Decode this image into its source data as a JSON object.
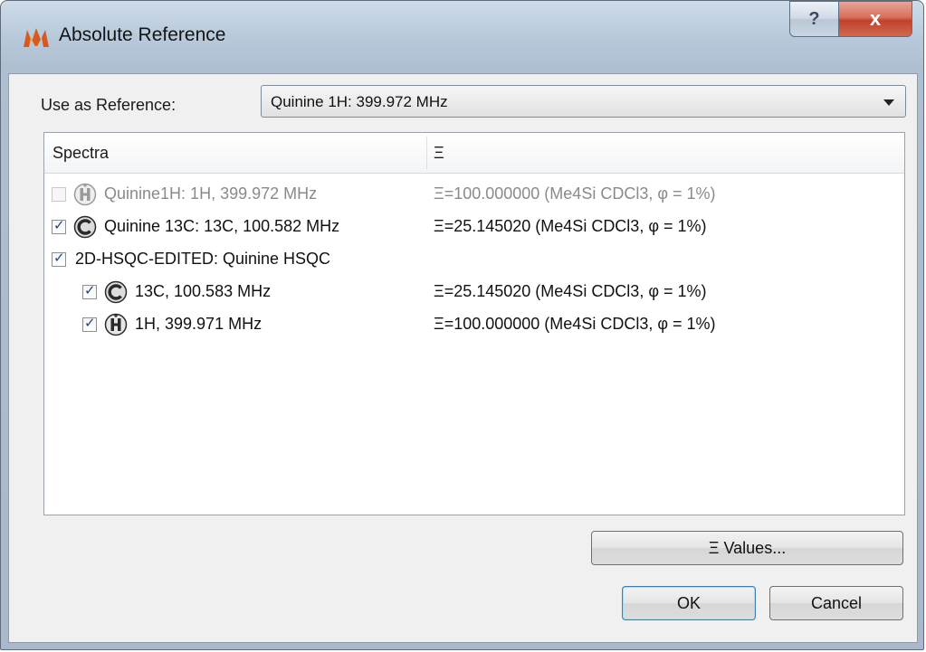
{
  "window": {
    "title": "Absolute Reference",
    "help_glyph": "?",
    "close_glyph": "x"
  },
  "reference": {
    "label": "Use as Reference:",
    "selected": "Quinine 1H: 399.972 MHz"
  },
  "columns": {
    "spectra": "Spectra",
    "xi": "Ξ"
  },
  "rows": [
    {
      "label": "Quinine1H: 1H, 399.972 MHz",
      "xi": "Ξ=100.000000 (Me4Si CDCl3, φ = 1%)",
      "checked": false,
      "disabled": true,
      "icon": "hydrogen-nucleus-icon",
      "indent": 0
    },
    {
      "label": "Quinine 13C: 13C, 100.582 MHz",
      "xi": "Ξ=25.145020 (Me4Si CDCl3, φ = 1%)",
      "checked": true,
      "disabled": false,
      "icon": "carbon-nucleus-icon",
      "indent": 0
    },
    {
      "label": "2D-HSQC-EDITED: Quinine HSQC",
      "xi": "",
      "checked": true,
      "disabled": false,
      "icon": "",
      "indent": 0
    },
    {
      "label": "13C, 100.583 MHz",
      "xi": "Ξ=25.145020 (Me4Si CDCl3, φ = 1%)",
      "checked": true,
      "disabled": false,
      "icon": "carbon-nucleus-icon",
      "indent": 1
    },
    {
      "label": "1H, 399.971 MHz",
      "xi": "Ξ=100.000000 (Me4Si CDCl3, φ = 1%)",
      "checked": true,
      "disabled": false,
      "icon": "hydrogen-nucleus-icon",
      "indent": 1
    }
  ],
  "buttons": {
    "values": "Ξ Values...",
    "ok": "OK",
    "cancel": "Cancel"
  },
  "colors": {
    "default_button_border": "#3c7fb1",
    "close_button": "#c2412a"
  }
}
